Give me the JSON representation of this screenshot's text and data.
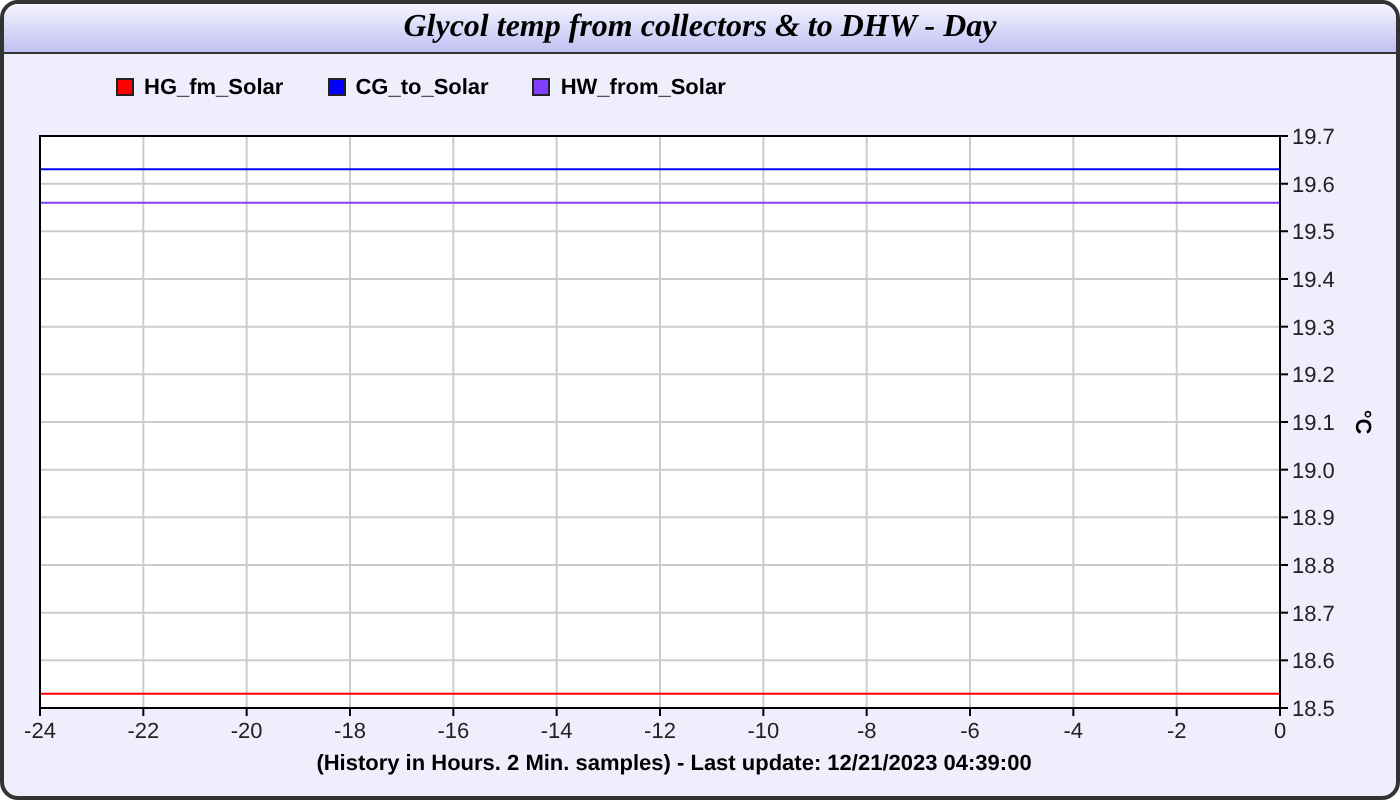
{
  "window": {
    "title": "Glycol temp from collectors & to DHW - Day"
  },
  "chart_data": {
    "type": "line",
    "xlabel": "(History in Hours. 2 Min. samples) - Last update: 12/21/2023 04:39:00",
    "ylabel": "°C",
    "x": [
      -24,
      0
    ],
    "series": [
      {
        "name": "HG_fm_Solar",
        "color": "#ff0000",
        "values": [
          18.53,
          18.53
        ]
      },
      {
        "name": "CG_to_Solar",
        "color": "#0000ff",
        "values": [
          19.63,
          19.63
        ]
      },
      {
        "name": "HW_from_Solar",
        "color": "#8040ff",
        "values": [
          19.56,
          19.56
        ]
      }
    ],
    "grid": true,
    "xlim": [
      -24,
      0
    ],
    "ylim": [
      18.5,
      19.7
    ],
    "xticks": [
      -24,
      -22,
      -20,
      -18,
      -16,
      -14,
      -12,
      -10,
      -8,
      -6,
      -4,
      -2,
      0
    ],
    "yticks": [
      {
        "value": 18.5,
        "label": "18.5"
      },
      {
        "value": 18.6,
        "label": "18.6"
      },
      {
        "value": 18.7,
        "label": "18.7"
      },
      {
        "value": 18.8,
        "label": "18.8"
      },
      {
        "value": 18.9,
        "label": "18.9"
      },
      {
        "value": 19.0,
        "label": "19.0"
      },
      {
        "value": 19.1,
        "label": "19.1"
      },
      {
        "value": 19.2,
        "label": "19.2"
      },
      {
        "value": 19.3,
        "label": "19.3"
      },
      {
        "value": 19.4,
        "label": "19.4"
      },
      {
        "value": 19.5,
        "label": "19.5"
      },
      {
        "value": 19.6,
        "label": "19.6"
      },
      {
        "value": 19.7,
        "label": "19.7"
      }
    ]
  }
}
